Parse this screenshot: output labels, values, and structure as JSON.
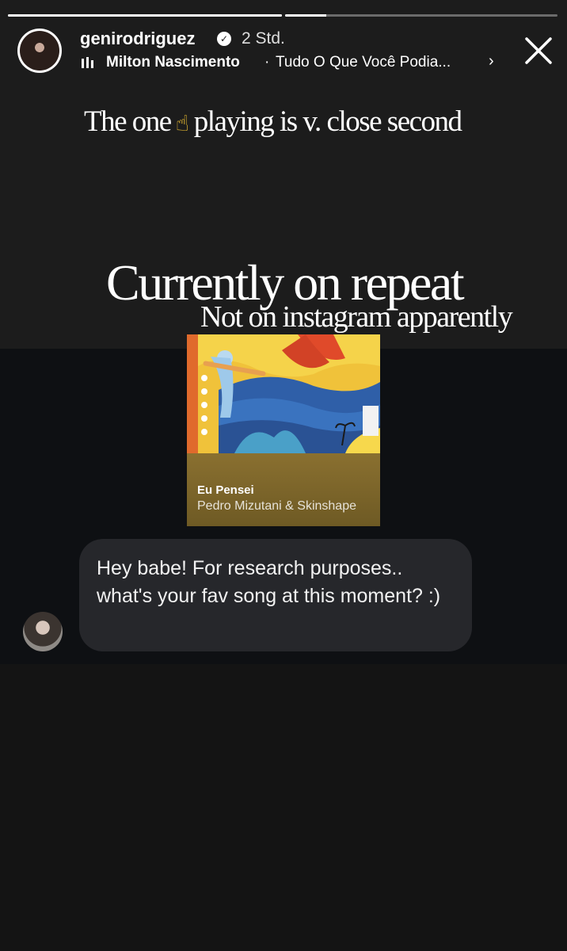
{
  "story": {
    "username": "genirodriguez",
    "timestamp": "2 Std.",
    "progress": [
      1.0,
      0.15
    ]
  },
  "music": {
    "artist": "Milton Nascimento",
    "separator": "·",
    "title": "Tudo O Que Você Podia...",
    "chevron": "›"
  },
  "overlay": {
    "line1_before": "The one",
    "line1_emoji": "☝",
    "line1_after": "playing is v. close second",
    "line2": "Currently on repeat",
    "line3": "Not on instagram apparently"
  },
  "album": {
    "song_title": "Eu Pensei",
    "song_artist": "Pedro Mizutani & Skinshape"
  },
  "message": {
    "text": "Hey babe! For research purposes.. what's your fav song at this moment? :)"
  },
  "icons": {
    "close": "close-icon",
    "verified": "verified-badge-icon",
    "music": "equalizer-icon"
  }
}
